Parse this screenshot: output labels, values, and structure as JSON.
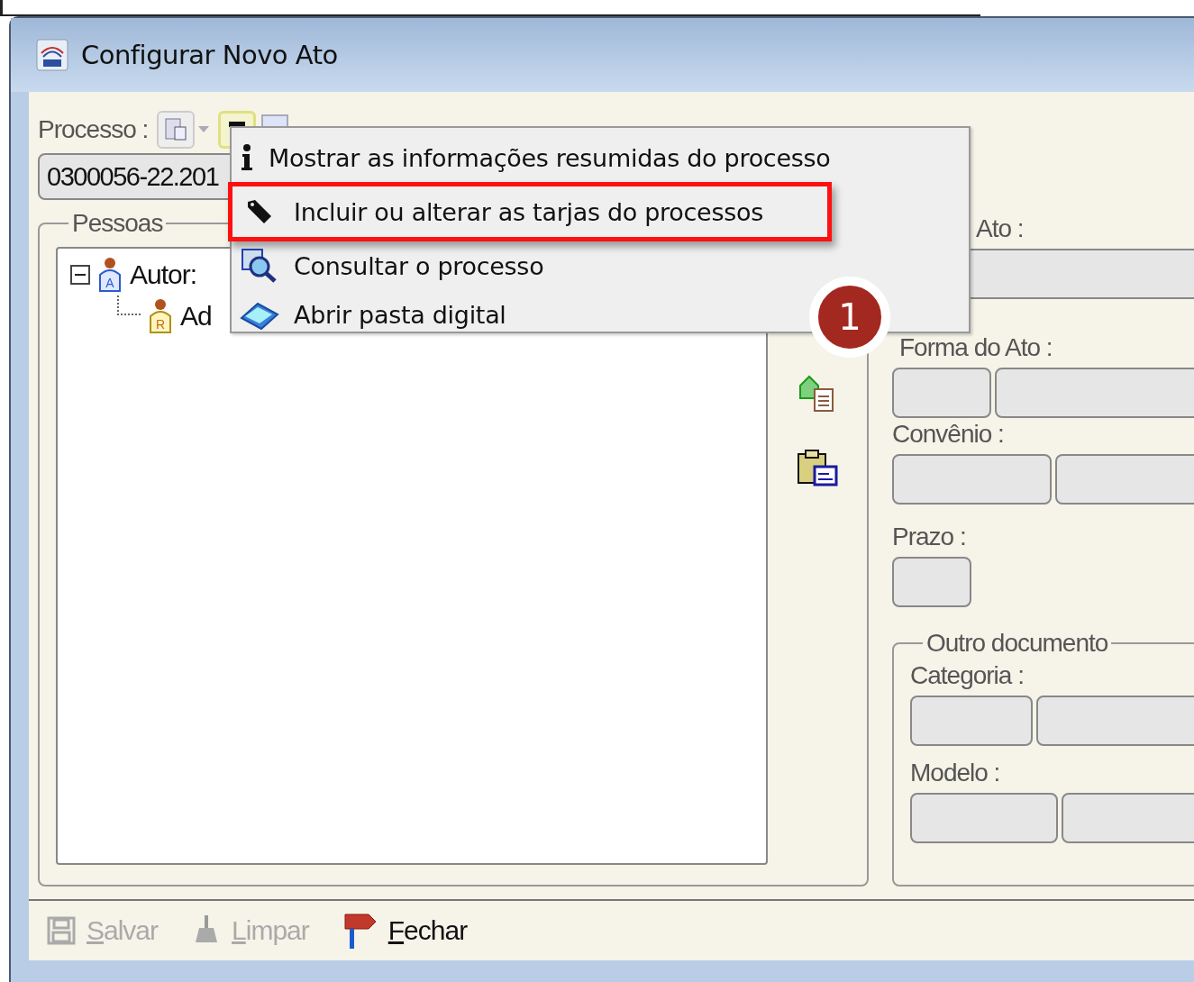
{
  "window": {
    "title": "Configurar Novo Ato"
  },
  "processo": {
    "label": "Processo :",
    "value": "0300056-22.201"
  },
  "pessoas": {
    "title": "Pessoas",
    "tree": [
      {
        "label": "Autor:",
        "role": "A",
        "expanded": true,
        "children": [
          {
            "label": "Ad",
            "role": "R"
          }
        ]
      }
    ]
  },
  "fields": [
    {
      "label": "Ato :",
      "kind": "single"
    },
    {
      "label": "Forma do Ato :",
      "kind": "pair"
    },
    {
      "label": "Convênio :",
      "kind": "pair"
    },
    {
      "label": "Prazo :",
      "kind": "short"
    }
  ],
  "outro_documento": {
    "title": "Outro documento",
    "fields": [
      {
        "label": "Categoria :",
        "kind": "pair"
      },
      {
        "label": "Modelo :",
        "kind": "pair"
      }
    ]
  },
  "toolbar": [
    {
      "label": "Salvar",
      "kind": "save",
      "disabled": true
    },
    {
      "label": "Limpar",
      "kind": "clear",
      "disabled": true
    },
    {
      "label": "Fechar",
      "kind": "close",
      "disabled": false
    }
  ],
  "context_menu": {
    "items": [
      {
        "kind": "info",
        "label": "Mostrar as informações resumidas do processo",
        "highlighted": false
      },
      {
        "kind": "tag",
        "label": "Incluir ou alterar as tarjas do processos",
        "highlighted": true
      },
      {
        "kind": "search",
        "label": "Consultar o processo",
        "highlighted": false
      },
      {
        "kind": "scanner",
        "label": "Abrir pasta digital",
        "highlighted": false
      }
    ]
  },
  "callout": {
    "number": "1"
  }
}
